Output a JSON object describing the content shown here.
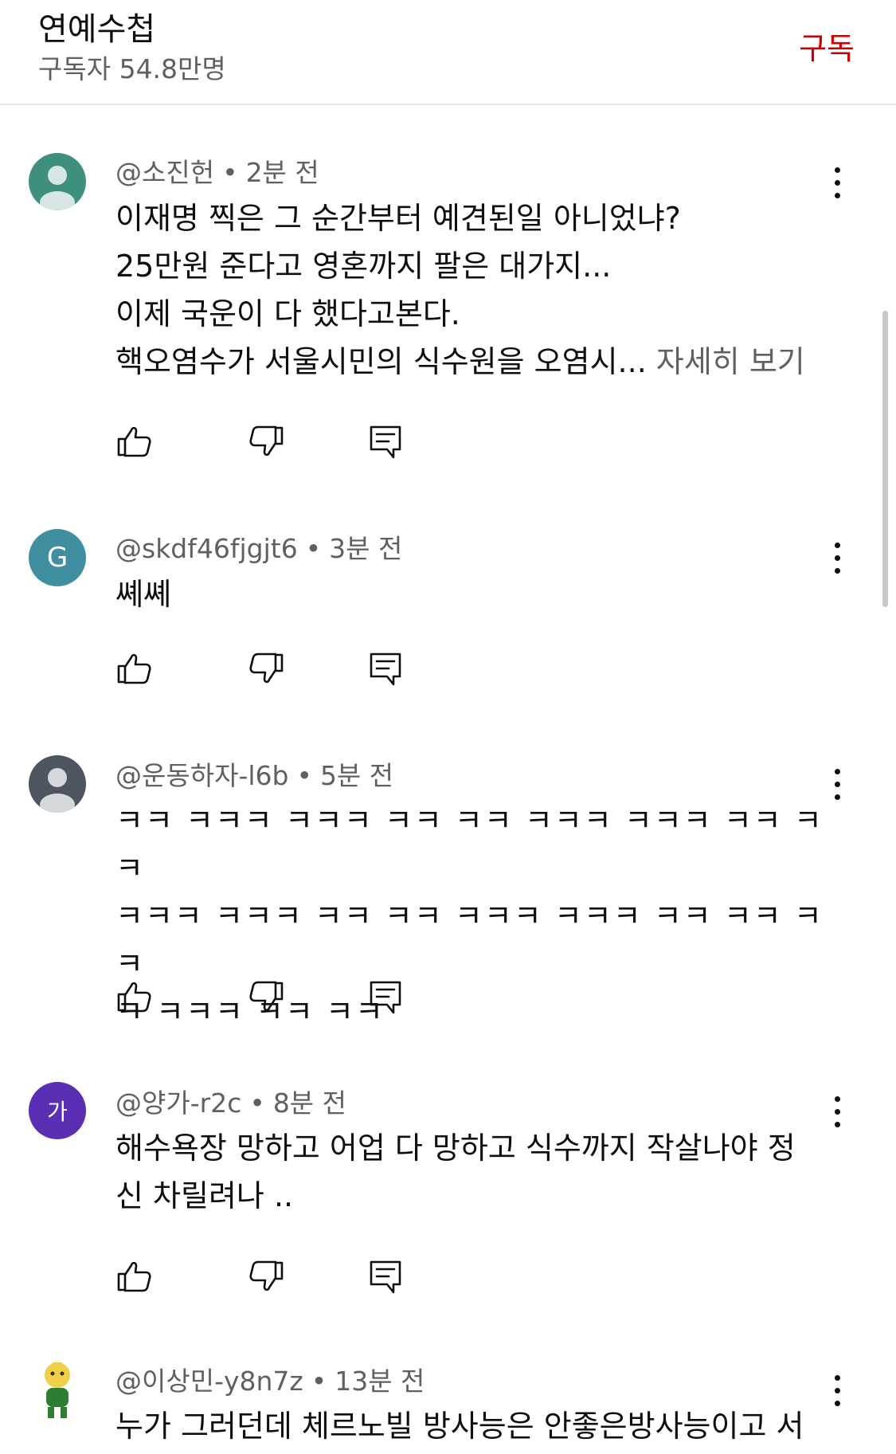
{
  "header": {
    "channel_name": "연예수첩",
    "subscribers": "구독자 54.8만명",
    "subscribe_label": "구독"
  },
  "comments": [
    {
      "author": "@소진헌",
      "time": "2분 전",
      "avatar_letter": "",
      "avatar_color": "#3f8f7f",
      "lines": [
        "이재명 찍은 그 순간부터 예견된일 아니었냐?",
        "25만원 준다고 영혼까지 팔은 대가지...",
        "이제 국운이 다 했다고본다.",
        "핵오염수가 서울시민의 식수원을 오염시..."
      ],
      "more_label": "자세히 보기"
    },
    {
      "author": "@skdf46fjgjt6",
      "time": "3분 전",
      "avatar_letter": "G",
      "avatar_color": "#3f8fa0",
      "lines": [
        "쎼쎼"
      ]
    },
    {
      "author": "@운동하자-l6b",
      "time": "5분 전",
      "avatar_letter": "",
      "avatar_color": "#4c5560",
      "lines": [
        "ㅋㅋ ㅋㅋㅋ ㅋㅋㅋ ㅋㅋ ㅋㅋ ㅋㅋㅋ ㅋㅋㅋ ㅋㅋ ㅋㅋ",
        "ㅋㅋㅋ ㅋㅋㅋ ㅋㅋ ㅋㅋ ㅋㅋㅋ ㅋㅋㅋ ㅋㅋ ㅋㅋ ㅋㅋ",
        "ㅋ ㅋㅋㅋ ㅋㅋ ㅋㅋ"
      ]
    },
    {
      "author": "@양가-r2c",
      "time": "8분 전",
      "avatar_letter": "가",
      "avatar_color": "#5b2fb3",
      "lines": [
        "해수욕장 망하고 어업 다 망하고 식수까지 작살나야 정",
        "신 차릴려나 .."
      ]
    },
    {
      "author": "@이상민-y8n7z",
      "time": "13분 전",
      "avatar_letter": "",
      "avatar_color": "#ffffff",
      "lines": [
        "누가 그러던데 체르노빌 방사능은 안좋은방사능이고 서"
      ]
    }
  ],
  "icons": {
    "like": "thumbs-up-icon",
    "dislike": "thumbs-down-icon",
    "reply": "reply-icon",
    "menu": "more-vertical-icon"
  }
}
